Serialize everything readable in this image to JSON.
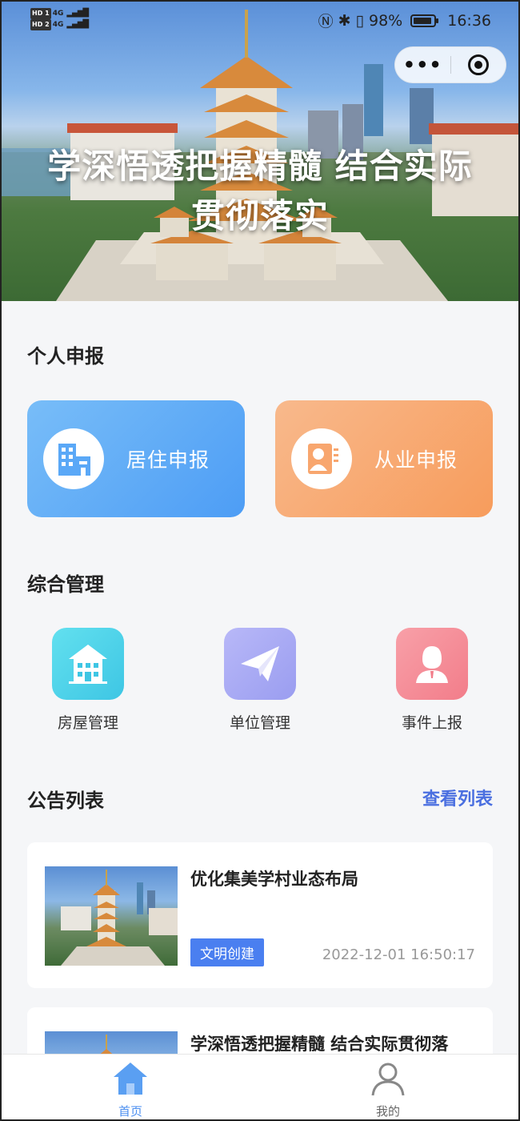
{
  "status_bar": {
    "hd1": "HD 1",
    "hd2": "HD 2",
    "net1": "4G",
    "net2": "4G",
    "battery": "98%",
    "time": "16:36"
  },
  "capsule": {
    "more": "•••"
  },
  "banner": {
    "line1": "学深悟透把握精髓 结合实际",
    "line2": "贯彻落实"
  },
  "personal": {
    "title": "个人申报",
    "cards": [
      {
        "label": "居住申报",
        "icon": "building-icon",
        "color": "#5aa8f7"
      },
      {
        "label": "从业申报",
        "icon": "id-card-icon",
        "color": "#f8a66e"
      }
    ]
  },
  "management": {
    "title": "综合管理",
    "items": [
      {
        "label": "房屋管理",
        "icon": "house-icon",
        "color": "#4dd6e8"
      },
      {
        "label": "单位管理",
        "icon": "paper-plane-icon",
        "color": "#a9a9f4"
      },
      {
        "label": "事件上报",
        "icon": "person-icon",
        "color": "#f58b96"
      }
    ]
  },
  "notices": {
    "title": "公告列表",
    "view_list": "查看列表",
    "items": [
      {
        "title": "优化集美学村业态布局",
        "tag": "文明创建",
        "time": "2022-12-01 16:50:17"
      },
      {
        "title": "学深悟透把握精髓 结合实际贯彻落"
      }
    ]
  },
  "tabbar": {
    "home": "首页",
    "mine": "我的"
  }
}
